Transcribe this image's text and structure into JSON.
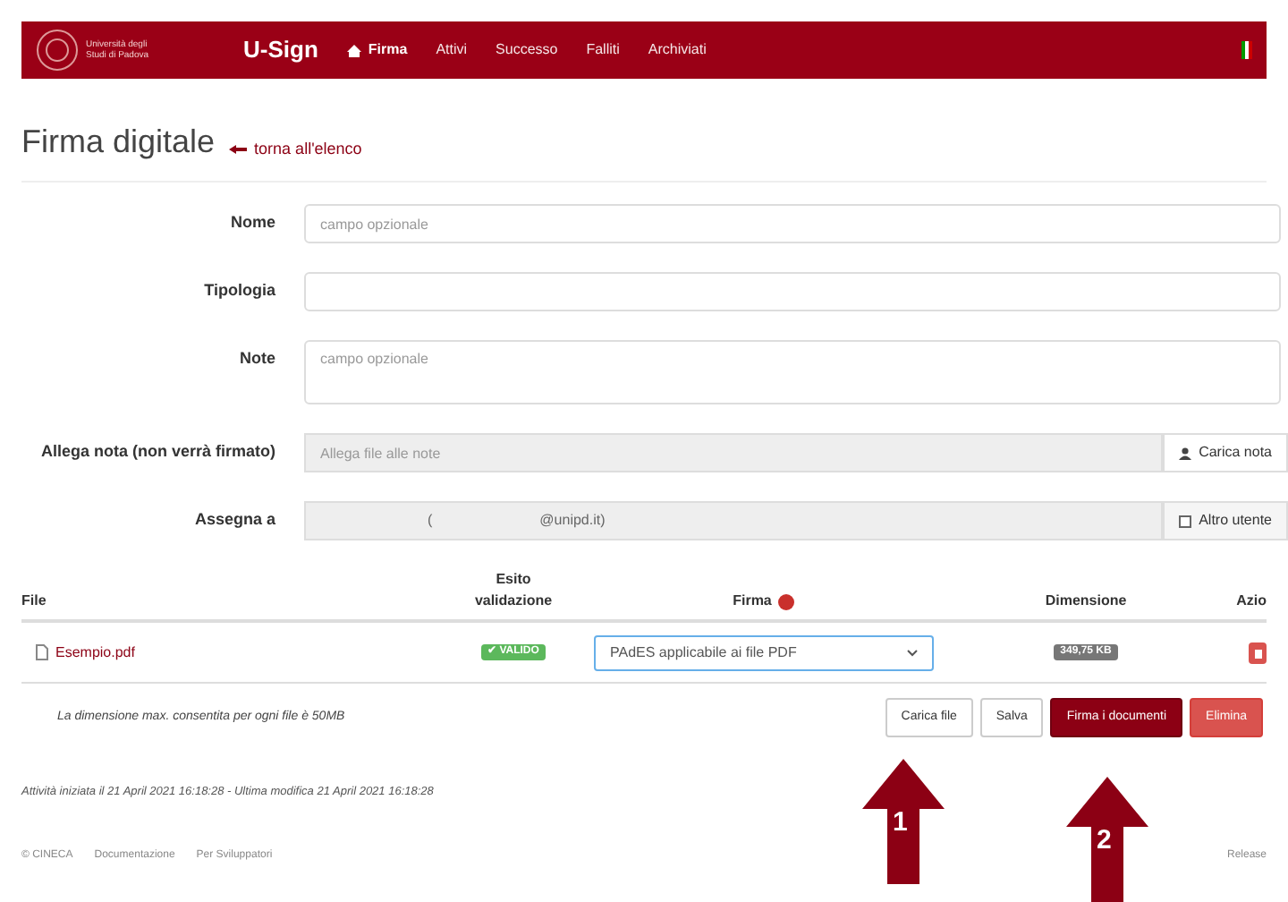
{
  "header": {
    "logo_text": "Università degli Studi di Padova",
    "app_name": "U-Sign",
    "nav": [
      {
        "label": "Firma",
        "selected": true
      },
      {
        "label": "Attivi",
        "selected": false
      },
      {
        "label": "Successo",
        "selected": false
      },
      {
        "label": "Falliti",
        "selected": false
      },
      {
        "label": "Archiviati",
        "selected": false
      }
    ]
  },
  "page": {
    "title": "Firma digitale",
    "back_link": "torna all'elenco"
  },
  "form": {
    "nome": {
      "label": "Nome",
      "placeholder": "campo opzionale"
    },
    "tipologia": {
      "label": "Tipologia"
    },
    "note": {
      "label": "Note",
      "placeholder": "campo opzionale"
    },
    "allega": {
      "label": "Allega nota (non verrà firmato)",
      "placeholder": "Allega file alle note",
      "button": "Carica nota"
    },
    "assegna": {
      "label": "Assegna a",
      "value_prefix": "(",
      "value_suffix": "@unipd.it)",
      "checkbox_label": "Altro utente",
      "checked": false
    }
  },
  "table": {
    "columns": [
      "File",
      "Esito validazione",
      "Firma",
      "Dimensione",
      "Azio"
    ],
    "rows": [
      {
        "file": "Esempio.pdf",
        "esito": "✔ VALIDO",
        "firma": "PAdES applicabile ai file PDF",
        "dimensione": "349,75 KB"
      }
    ]
  },
  "note_max": "La dimensione max. consentita per ogni file è 50MB",
  "buttons": [
    {
      "label": "Carica file",
      "kind": "default"
    },
    {
      "label": "Salva",
      "kind": "default"
    },
    {
      "label": "Firma i documenti",
      "kind": "primary"
    },
    {
      "label": "Elimina",
      "kind": "danger"
    }
  ],
  "activity": "Attività iniziata il 21 April 2021 16:18:28 - Ultima modifica 21 April 2021 16:18:28",
  "footer": {
    "links": [
      "© CINECA",
      "Documentazione",
      "Per Sviluppatori"
    ],
    "release": "Release"
  },
  "annotations": [
    {
      "number": "1"
    },
    {
      "number": "2"
    }
  ]
}
